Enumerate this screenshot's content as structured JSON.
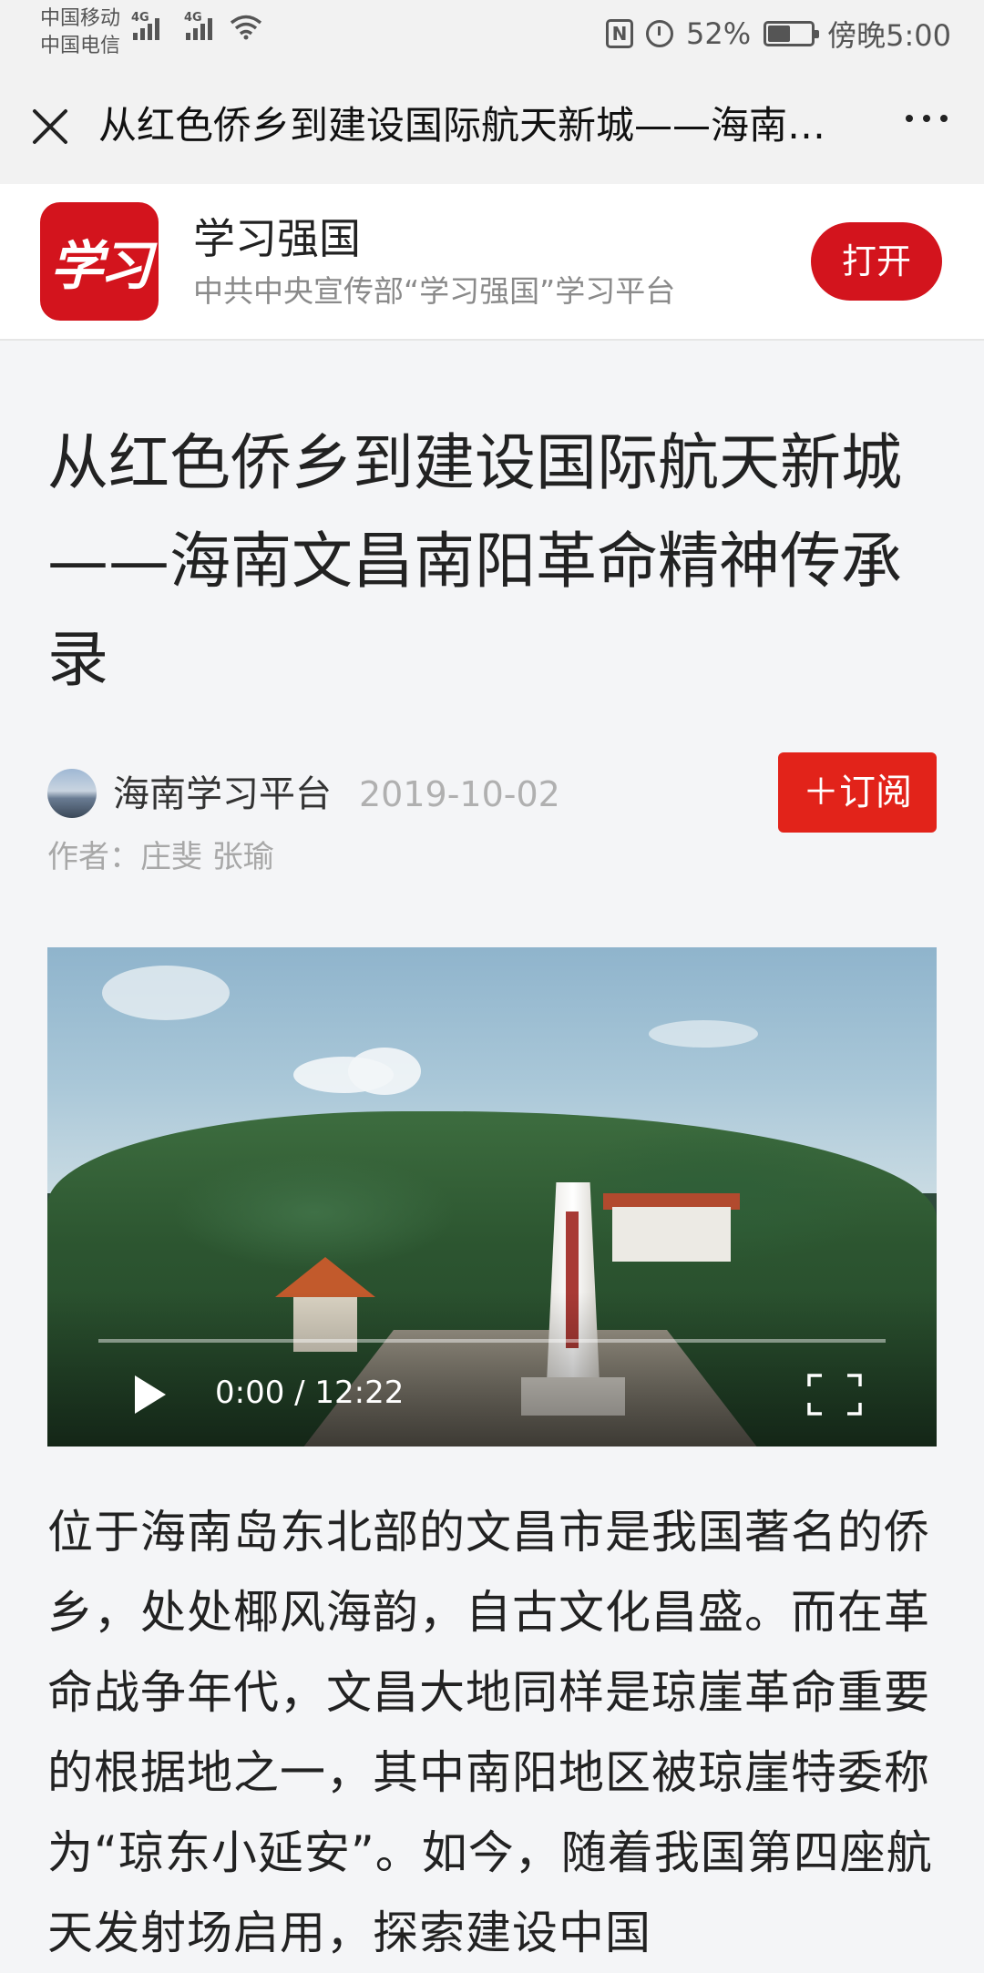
{
  "status_bar": {
    "carrier_1": "中国移动",
    "carrier_2": "中国电信",
    "network_1": "4G",
    "network_2": "4G",
    "battery": "52%",
    "battery_level": 0.52,
    "time": "傍晚5:00"
  },
  "titlebar": {
    "title": "从红色侨乡到建设国际航天新城——海南文昌南阳革命精神传承录"
  },
  "app_banner": {
    "logo_text": "学习",
    "name": "学习强国",
    "description": "中共中央宣传部“学习强国”学习平台",
    "open_label": "打开"
  },
  "article": {
    "title": "从红色侨乡到建设国际航天新城——海南文昌南阳革命精神传承录",
    "source": "海南学习平台",
    "date": "2019-10-02",
    "subscribe_label": "＋订阅",
    "author": "作者：庄斐 张瑜",
    "video": {
      "time": "0:00 / 12:22"
    },
    "body": "位于海南岛东北部的文昌市是我国著名的侨乡，处处椰风海韵，自古文化昌盛。而在革命战争年代，文昌大地同样是琼崖革命重要的根据地之一，其中南阳地区被琼崖特委称为“琼东小延安”。如今，随着我国第四座航天发射场启用，探索建设中国"
  },
  "colors": {
    "accent_red": "#d3141d",
    "subscribe_red": "#e2231a"
  }
}
